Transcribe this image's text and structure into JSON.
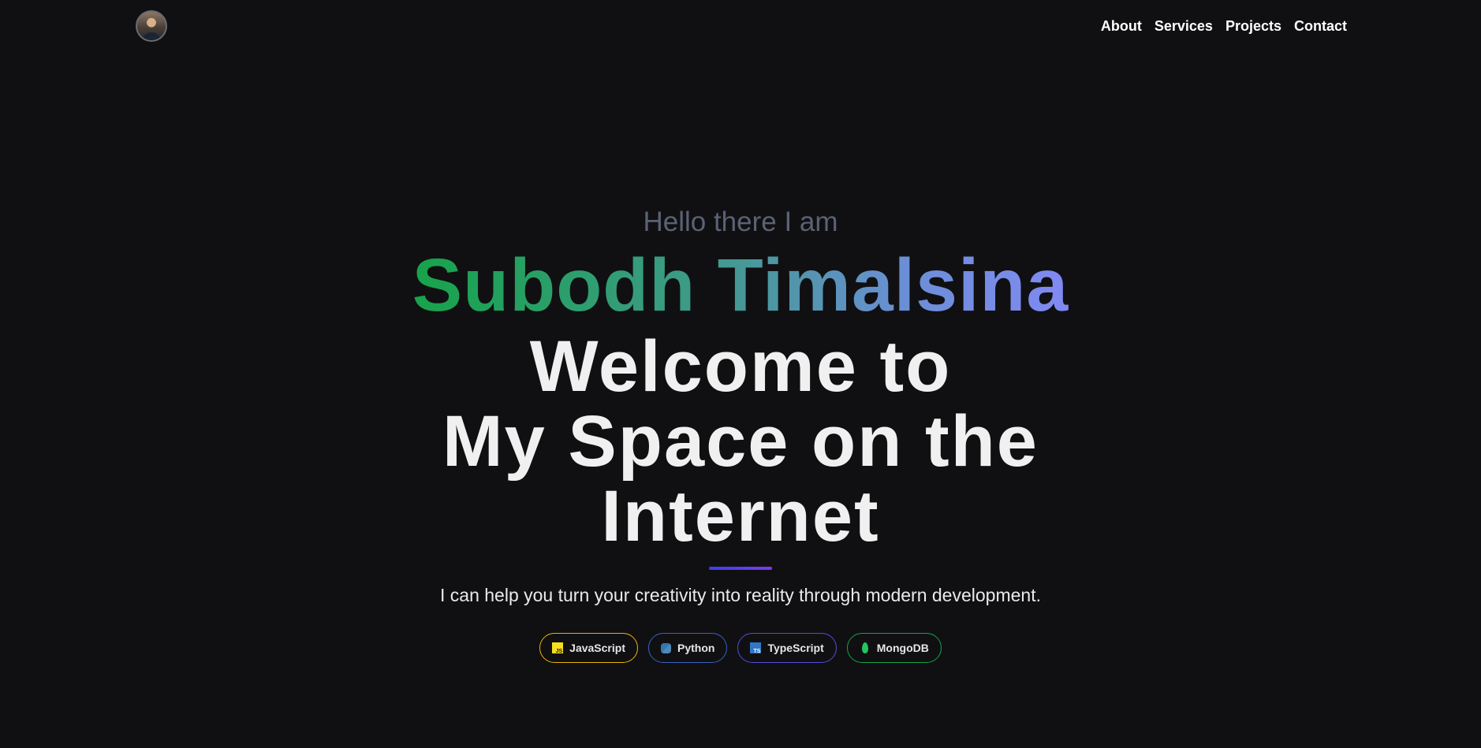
{
  "nav": {
    "avatar_icon": "profile-photo",
    "links": [
      {
        "label": "About"
      },
      {
        "label": "Services"
      },
      {
        "label": "Projects"
      },
      {
        "label": "Contact"
      }
    ]
  },
  "hero": {
    "greeting": "Hello there I am",
    "name": "Subodh Timalsina",
    "headline_lines": [
      "Welcome to",
      "My Space on the",
      "Internet"
    ],
    "tagline": "I can help you turn your creativity into reality through modern development.",
    "badges": [
      {
        "label": "JavaScript",
        "icon": "javascript-icon",
        "color": "#eab308"
      },
      {
        "label": "Python",
        "icon": "python-icon",
        "color": "#3b5fc4"
      },
      {
        "label": "TypeScript",
        "icon": "typescript-icon",
        "color": "#4f4fd8"
      },
      {
        "label": "MongoDB",
        "icon": "mongodb-icon",
        "color": "#16a34a"
      }
    ]
  },
  "colors": {
    "background": "#101012",
    "name_gradient_start": "#17a34a",
    "name_gradient_end": "#8189f4",
    "accent_bar": "#4f46e5"
  }
}
